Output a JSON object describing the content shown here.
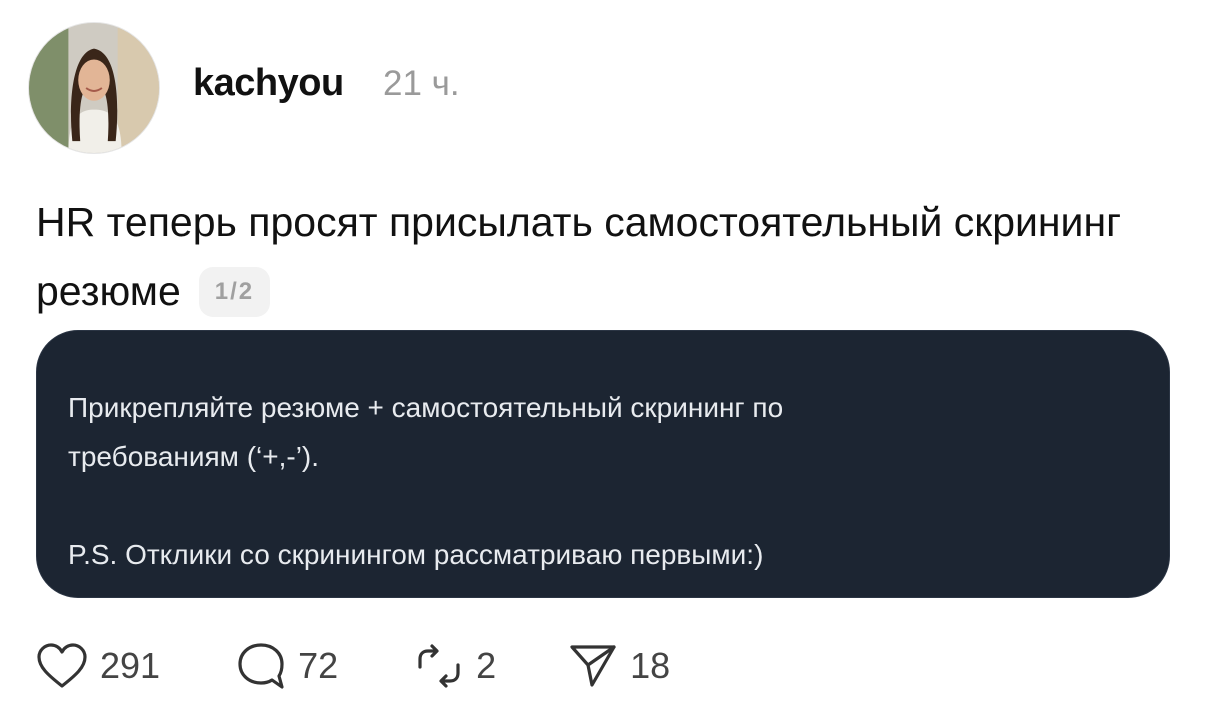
{
  "post": {
    "author": "kachyou",
    "timestamp": "21 ч.",
    "text": "HR теперь просят присылать самостоятельный скрининг резюме",
    "page_indicator": "1/2"
  },
  "card": {
    "lines": [
      "Прикрепляйте резюме + самостоятельный скрининг по",
      "требованиям (‘+,-’).",
      "P.S. Отклики со скринингом рассматриваю первыми:)"
    ]
  },
  "actions": {
    "likes": "291",
    "comments": "72",
    "reposts": "2",
    "shares": "18"
  },
  "icons": {
    "like": "heart-icon",
    "comment": "comment-bubble-icon",
    "repost": "repost-icon",
    "share": "send-icon"
  },
  "colors": {
    "card_background": "#1c2532",
    "card_text": "#e8ebef",
    "muted": "#9a9a9a"
  }
}
